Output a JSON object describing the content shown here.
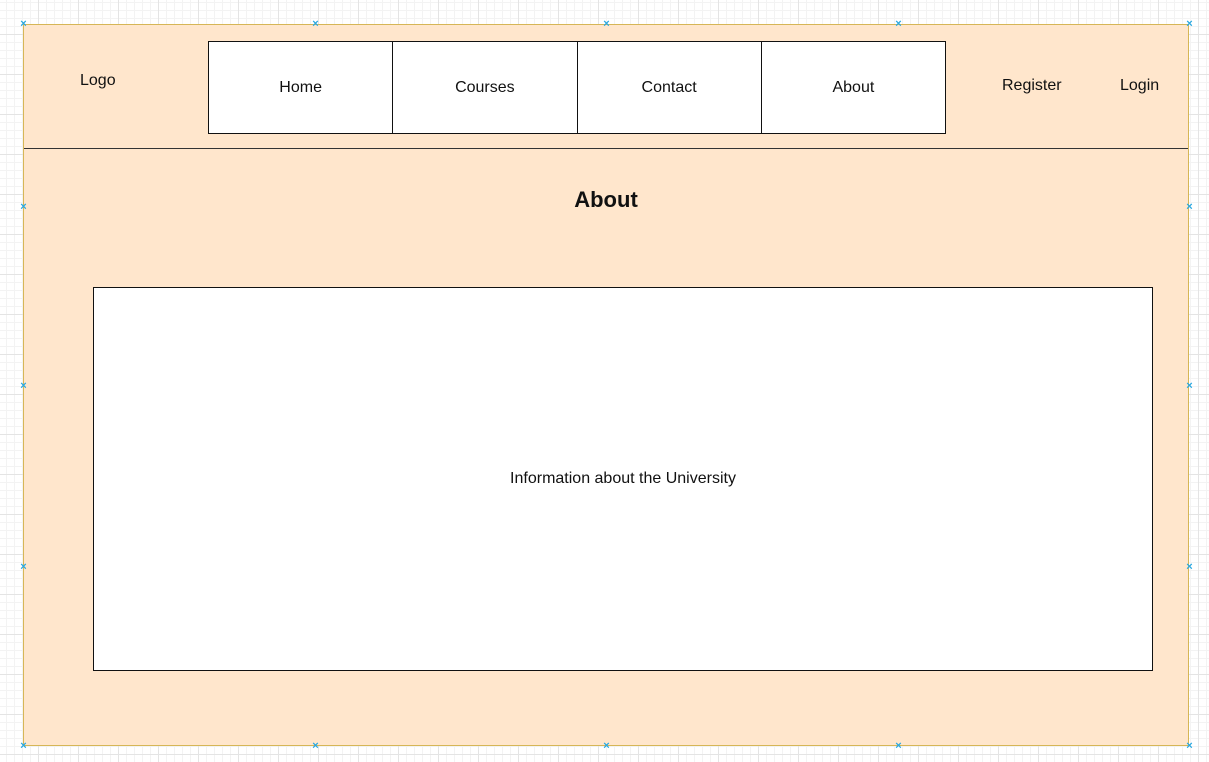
{
  "header": {
    "logo": "Logo",
    "nav": [
      {
        "label": "Home"
      },
      {
        "label": "Courses"
      },
      {
        "label": "Contact"
      },
      {
        "label": "About"
      }
    ],
    "register": "Register",
    "login": "Login"
  },
  "main": {
    "title": "About",
    "content": "Information about the University"
  },
  "colors": {
    "frame_fill": "#ffe6cc",
    "frame_border": "#d6b656",
    "selection_handle": "#29a8e0"
  }
}
